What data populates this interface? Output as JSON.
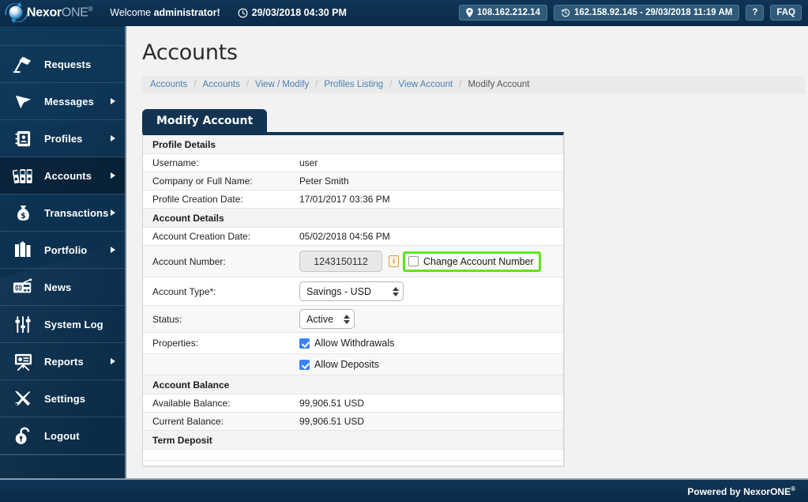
{
  "brand": {
    "name_bold": "Nexor",
    "name_dim": "ONE",
    "registered": "®",
    "logo_icon": "globe-swoosh-icon"
  },
  "topbar": {
    "welcome_prefix": "Welcome ",
    "welcome_user": "administrator!",
    "clock_icon": "clock-icon",
    "datetime": "29/03/2018 04:30 PM",
    "current_ip": {
      "icon": "location-pin-icon",
      "text": "108.162.212.14"
    },
    "last_login": {
      "icon": "history-clock-icon",
      "text": "162.158.92.145 - 29/03/2018 11:19 AM"
    },
    "help_button": "?",
    "faq_button": "FAQ"
  },
  "sidebar": {
    "items": [
      {
        "label": "Requests",
        "icon": "desk-lamp-icon",
        "has_arrow": false,
        "active": false
      },
      {
        "label": "Messages",
        "icon": "cursor-arrow-icon",
        "has_arrow": true,
        "active": false
      },
      {
        "label": "Profiles",
        "icon": "address-book-icon",
        "has_arrow": true,
        "active": false
      },
      {
        "label": "Accounts",
        "icon": "binders-icon",
        "has_arrow": true,
        "active": true
      },
      {
        "label": "Transactions",
        "icon": "money-bag-icon",
        "has_arrow": true,
        "active": false
      },
      {
        "label": "Portfolio",
        "icon": "briefcase-icon",
        "has_arrow": true,
        "active": false
      },
      {
        "label": "News",
        "icon": "radio-icon",
        "has_arrow": false,
        "active": false
      },
      {
        "label": "System Log",
        "icon": "sliders-icon",
        "has_arrow": false,
        "active": false
      },
      {
        "label": "Reports",
        "icon": "presentation-icon",
        "has_arrow": true,
        "active": false
      },
      {
        "label": "Settings",
        "icon": "tools-icon",
        "has_arrow": false,
        "active": false
      },
      {
        "label": "Logout",
        "icon": "unlocked-padlock-icon",
        "has_arrow": false,
        "active": false
      }
    ]
  },
  "page": {
    "title": "Accounts",
    "breadcrumb": [
      {
        "label": "Accounts",
        "current": false
      },
      {
        "label": "Accounts",
        "current": false
      },
      {
        "label": "View / Modify",
        "current": false
      },
      {
        "label": "Profiles Listing",
        "current": false
      },
      {
        "label": "View Account",
        "current": false
      },
      {
        "label": "Modify Account",
        "current": true
      }
    ],
    "breadcrumb_separator": "/",
    "tab_label": "Modify Account"
  },
  "form": {
    "sections": [
      {
        "heading": "Profile Details",
        "rows": [
          {
            "label": "Username:",
            "value": "user"
          },
          {
            "label": "Company or Full Name:",
            "value": "Peter Smith"
          },
          {
            "label": "Profile Creation Date:",
            "value": "17/01/2017 03:36 PM"
          }
        ]
      },
      {
        "heading": "Account Details",
        "rows": [
          {
            "label": "Account Creation Date:",
            "value": "05/02/2018 04:56 PM"
          }
        ]
      }
    ],
    "account_number": {
      "label": "Account Number:",
      "value": "1243150112",
      "info_icon": "info-icon",
      "info_icon_glyph": "i",
      "change_checkbox_label": "Change Account Number",
      "change_checkbox_checked": false,
      "highlight_color": "#5ee619"
    },
    "account_type": {
      "label": "Account Type*:",
      "selected": "Savings - USD"
    },
    "status": {
      "label": "Status:",
      "selected": "Active"
    },
    "properties": {
      "label": "Properties:",
      "options": [
        {
          "label": "Allow Withdrawals",
          "checked": true
        },
        {
          "label": "Allow Deposits",
          "checked": true
        }
      ]
    },
    "account_balance": {
      "heading": "Account Balance",
      "rows": [
        {
          "label": "Available Balance:",
          "value": "99,906.51 USD"
        },
        {
          "label": "Current Balance:",
          "value": "99,906.51 USD"
        }
      ]
    },
    "term_deposit": {
      "heading": "Term Deposit"
    }
  },
  "footer": {
    "powered_by": "Powered by NexorONE",
    "registered": "®"
  },
  "colors": {
    "navy": "#0f3455",
    "navy_dark": "#0b2c49",
    "tab_navy": "#123452",
    "accent_blue": "#4a7fb5",
    "checkbox_blue": "#3b82f6",
    "highlight_green": "#5ee619",
    "info_orange": "#e8922a"
  }
}
